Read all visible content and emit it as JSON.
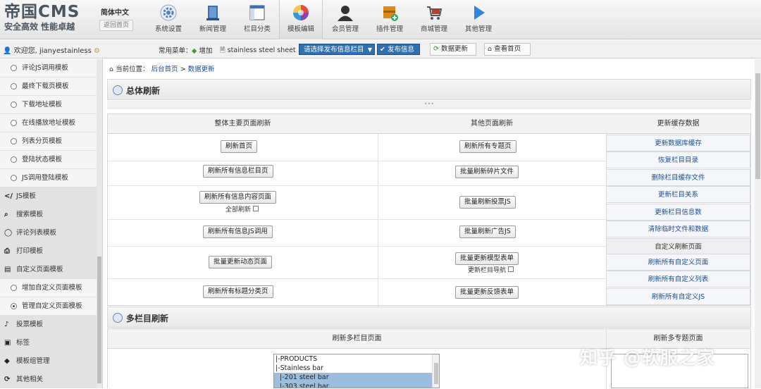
{
  "header": {
    "brand": "帝国CMS",
    "slogan": "安全高效 性能卓越",
    "language": "简体中文",
    "home_link": "返回首页",
    "nav": [
      {
        "label": "系统设置",
        "icon": "gear-icon"
      },
      {
        "label": "新闻管理",
        "icon": "document-icon"
      },
      {
        "label": "栏目分类",
        "icon": "category-icon"
      },
      {
        "label": "模板编辑",
        "icon": "color-wheel-icon"
      },
      {
        "label": "会员管理",
        "icon": "user-icon"
      },
      {
        "label": "插件管理",
        "icon": "plugin-icon"
      },
      {
        "label": "商城管理",
        "icon": "cart-icon"
      },
      {
        "label": "其他管理",
        "icon": "play-icon"
      }
    ]
  },
  "subbar": {
    "welcome": "欢迎您, jianyestainless",
    "common_menu": "常用菜单：",
    "add": "增加",
    "stainless": "stainless steel sheet",
    "column_select": "请选择发布信息栏目",
    "publish": "发布信息",
    "data_update": "数据更新",
    "view_home": "查看首页"
  },
  "sidebar": {
    "items": [
      {
        "label": "评论JS调用模板",
        "kind": "sub"
      },
      {
        "label": "最终下载页模板",
        "kind": "sub"
      },
      {
        "label": "下载地址模板",
        "kind": "sub"
      },
      {
        "label": "在线播放地址模板",
        "kind": "sub"
      },
      {
        "label": "列表分页模板",
        "kind": "sub"
      },
      {
        "label": "登陆状态模板",
        "kind": "sub"
      },
      {
        "label": "JS调用登陆模板",
        "kind": "sub"
      },
      {
        "label": "JS模板",
        "kind": "top",
        "icon": "code-icon"
      },
      {
        "label": "搜索模板",
        "kind": "top",
        "icon": "search-icon"
      },
      {
        "label": "评论列表模板",
        "kind": "top",
        "icon": "comment-icon"
      },
      {
        "label": "打印模板",
        "kind": "top",
        "icon": "printer-icon"
      },
      {
        "label": "自定义页面模板",
        "kind": "top",
        "icon": "page-icon"
      },
      {
        "label": "增加自定义页面模板",
        "kind": "sub"
      },
      {
        "label": "管理自定义页面模板",
        "kind": "sub",
        "selected": true
      },
      {
        "label": "投票模板",
        "kind": "top",
        "icon": "microphone-icon"
      },
      {
        "label": "标签",
        "kind": "top",
        "icon": "tag-icon"
      },
      {
        "label": "模板组管理",
        "kind": "top",
        "icon": "shield-icon"
      },
      {
        "label": "其他相关",
        "kind": "top",
        "icon": "refresh-icon"
      }
    ]
  },
  "breadcrumb": {
    "prefix": "当前位置：",
    "home": "后台首页",
    "sep": ">",
    "current": "数据更新"
  },
  "overall": {
    "title": "总体刷新",
    "col_main": "整体主要页面刷新",
    "col_other": "其他页面刷新",
    "col_cache": "更新缓存数据",
    "main_buttons": [
      "刷新首页",
      "刷新所有信息栏目页",
      "刷新所有信息内容页面",
      "刷新所有信息JS调用",
      "批量更新动态页面",
      "刷新所有标题分类页"
    ],
    "full_refresh_note": "全部刷新",
    "other_buttons": [
      "刷新所有专题页",
      "批量刷新碎片文件",
      "批量刷新投票JS",
      "批量刷新广告JS",
      "批量更新模型表单",
      "批量更新反馈表单"
    ],
    "column_nav_note": "更新栏目导航",
    "cache_links": [
      "更新数据库缓存",
      "恢复栏目目录",
      "删除栏目缓存文件",
      "更新栏目关系",
      "更新栏目信息数",
      "清除临时文件和数据"
    ],
    "custom_refresh_label": "自定义刷新页面",
    "custom_links": [
      "刷新所有自定义页面",
      "刷新所有自定义列表",
      "刷新所有自定义JS"
    ]
  },
  "multi": {
    "title": "多栏目刷新",
    "col_pages": "刷新多栏目页面",
    "col_topics": "刷新多专题页面",
    "options": [
      {
        "label": "|-PRODUCTS",
        "selected": false
      },
      {
        "label": "|-Stainless bar",
        "selected": false
      },
      {
        "label": "  |-201 steel bar",
        "selected": true
      },
      {
        "label": "  |-303 steel bar",
        "selected": true
      }
    ]
  },
  "watermark": "知乎 @软服之家"
}
